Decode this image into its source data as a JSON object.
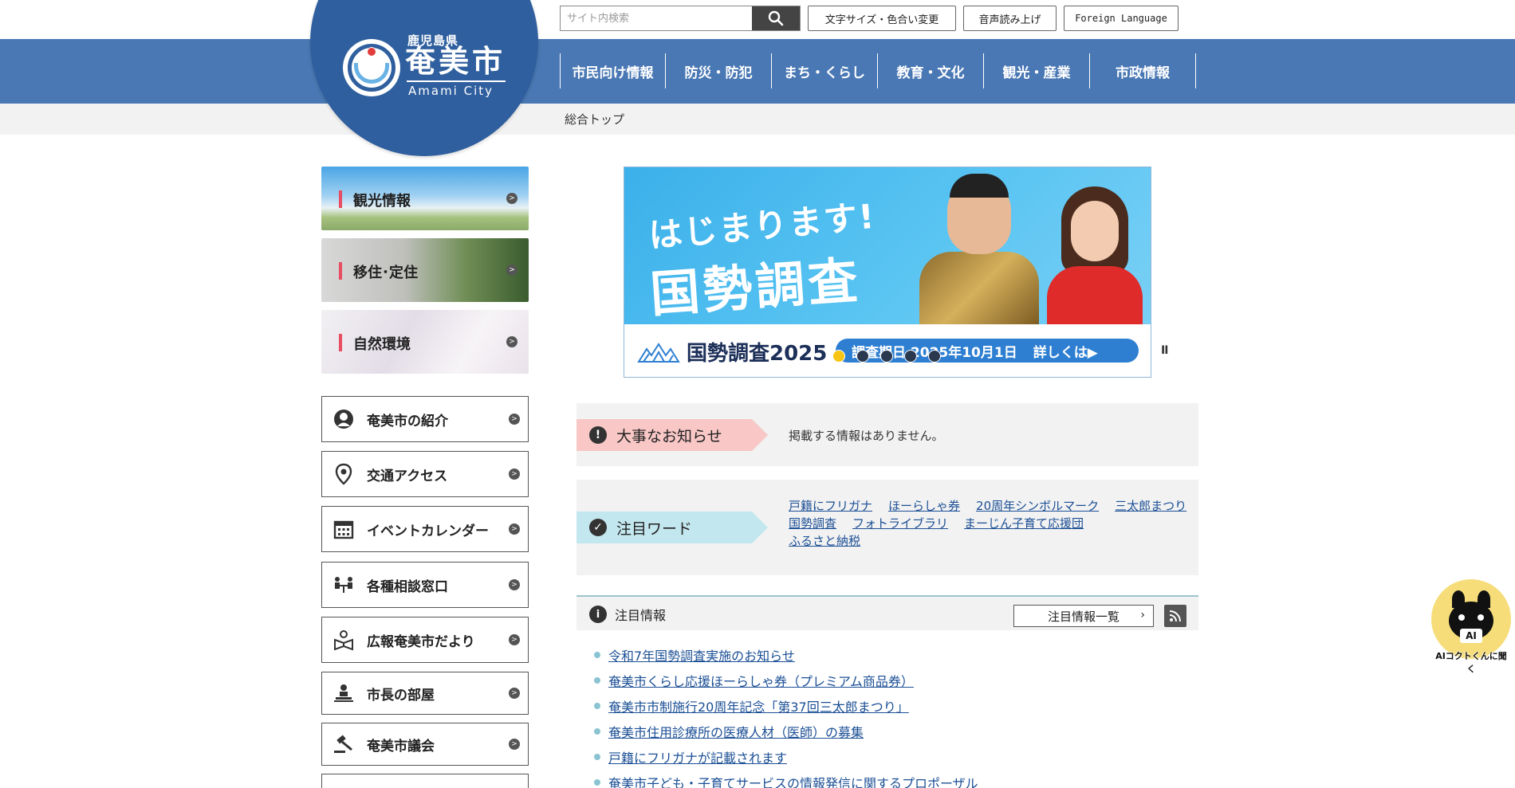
{
  "header": {
    "logo": {
      "prefecture": "鹿児島県",
      "city_name": "奄美市",
      "city_name_en": "Amami City"
    },
    "search": {
      "placeholder": "サイト内検索",
      "value": ""
    },
    "utility_buttons": {
      "text_size": "文字サイズ・色合い変更",
      "voice_reading": "音声読み上げ",
      "foreign_language": "Foreign Language"
    },
    "global_nav": [
      {
        "label": "市民向け情報"
      },
      {
        "label": "防災・防犯"
      },
      {
        "label": "まち・くらし"
      },
      {
        "label": "教育・文化"
      },
      {
        "label": "観光・産業"
      },
      {
        "label": "市政情報"
      }
    ],
    "breadcrumb": "総合トップ"
  },
  "sidebar": {
    "photo_links": [
      {
        "label": "観光情報"
      },
      {
        "label": "移住･定住"
      },
      {
        "label": "自然環境"
      }
    ],
    "menu": [
      {
        "label": "奄美市の紹介",
        "icon": "person-icon"
      },
      {
        "label": "交通アクセス",
        "icon": "map-pin-icon"
      },
      {
        "label": "イベントカレンダー",
        "icon": "calendar-icon"
      },
      {
        "label": "各種相談窓口",
        "icon": "consultation-icon"
      },
      {
        "label": "広報奄美市だより",
        "icon": "newsletter-icon"
      },
      {
        "label": "市長の部屋",
        "icon": "mayor-icon"
      },
      {
        "label": "奄美市議会",
        "icon": "gavel-icon"
      }
    ]
  },
  "banner": {
    "headline": "はじまります!",
    "headline_main": "国勢調査",
    "logo_text": "国勢調査2025",
    "pill_text": "調査期日 2025年10月1日",
    "pill_link": "詳しくは▶",
    "slide_count": 5,
    "active_slide": 1,
    "pause_label": "II"
  },
  "important_notice": {
    "label": "大事なお知らせ",
    "text": "掲載する情報はありません。"
  },
  "keywords": {
    "label": "注目ワード",
    "items": [
      "戸籍にフリガナ",
      "ほーらしゃ券",
      "20周年シンボルマーク",
      "三太郎まつり",
      "国勢調査",
      "フォトライブラリ",
      "まーじん子育て応援団",
      "ふるさと納税"
    ]
  },
  "featured_info": {
    "title": "注目情報",
    "list_button": "注目情報一覧",
    "items": [
      "令和7年国勢調査実施のお知らせ",
      "奄美市くらし応援ほーらしゃ券（プレミアム商品券）",
      "奄美市市制施行20周年記念「第37回三太郎まつり」",
      "奄美市住用診療所の医療人材（医師）の募集",
      "戸籍にフリガナが記載されます",
      "奄美市子ども・子育てサービスの情報発信に関するプロポーザル"
    ]
  },
  "ai_chat": {
    "badge": "AI",
    "caption": "AIコクトくんに聞く"
  },
  "colors": {
    "nav_blue": "#4a78b4",
    "logo_blue": "#2f5f9e",
    "link_blue": "#1b4f95",
    "notice_red": "#f8c7c6",
    "keyword_cyan": "#c3e7ef"
  }
}
